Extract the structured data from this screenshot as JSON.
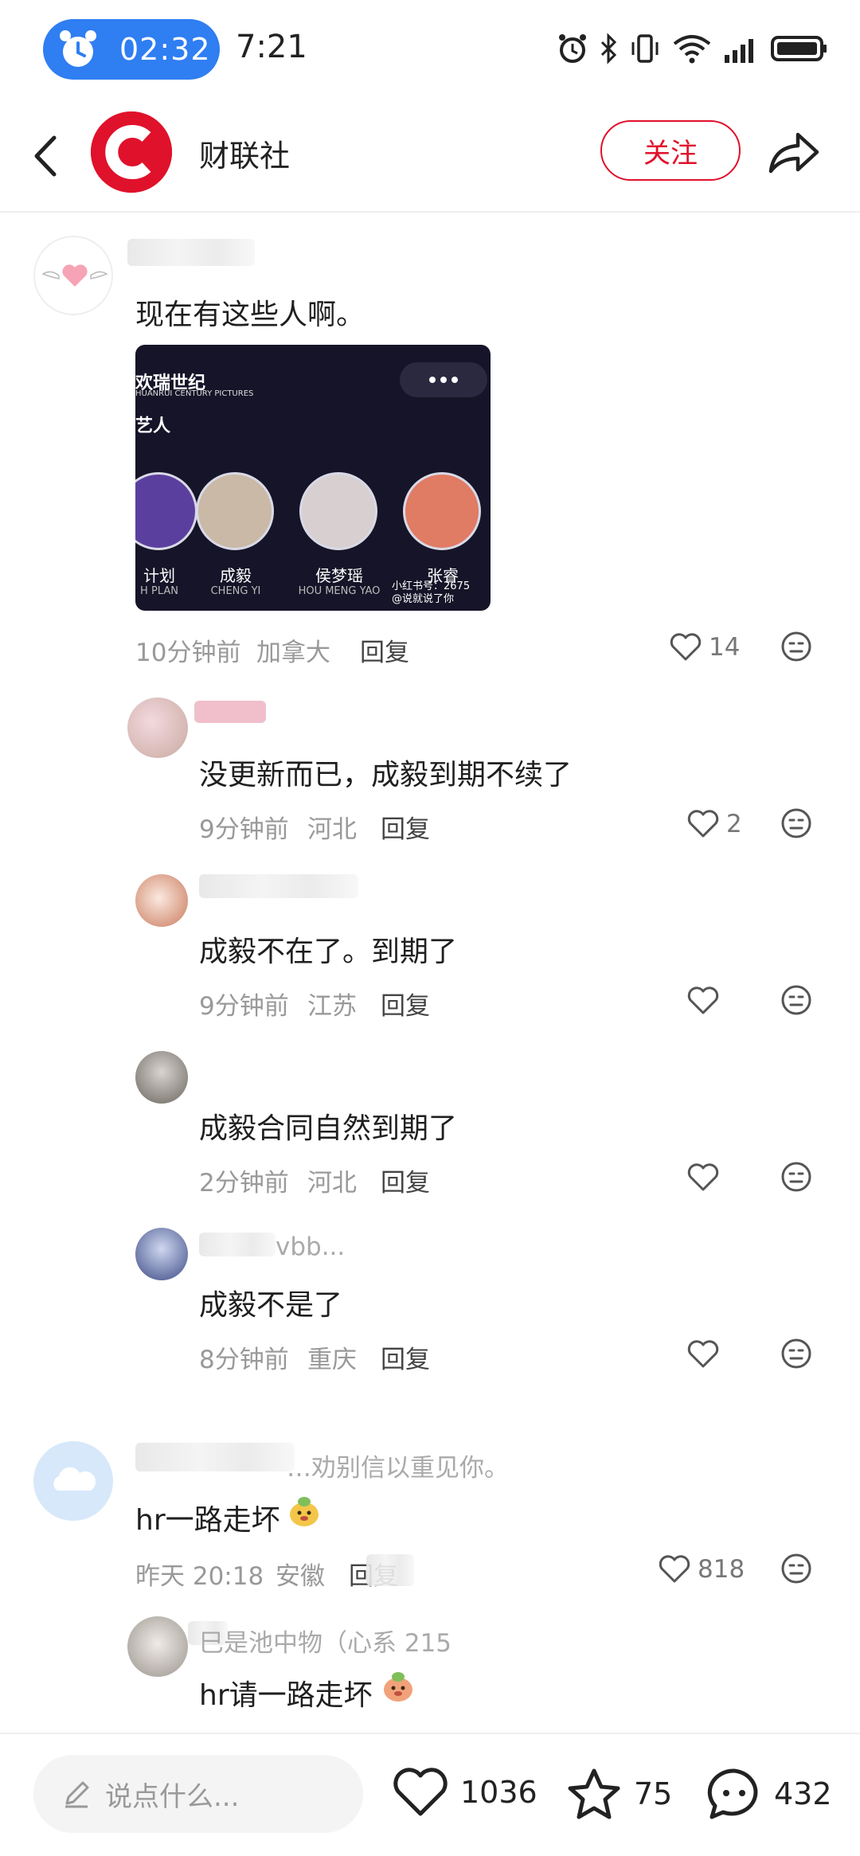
{
  "status_bar": {
    "alarm_time": "02:32",
    "clock": "7:21"
  },
  "header": {
    "brand_name": "财联社",
    "follow_label": "关注"
  },
  "comments": [
    {
      "text": "现在有这些人啊。",
      "time": "10分钟前",
      "location": "加拿大",
      "reply_label": "回复",
      "likes": "14",
      "image": {
        "studio": "欢瑞世纪",
        "studio_sub": "HUANRUI CENTURY PICTURES",
        "section": "艺人",
        "stars": [
          {
            "name": "计划",
            "en": "H PLAN"
          },
          {
            "name": "成毅",
            "en": "CHENG YI"
          },
          {
            "name": "侯梦瑶",
            "en": "HOU MENG YAO"
          },
          {
            "name": "张睿",
            "en": ""
          }
        ],
        "watermark_1": "小红书号：2675",
        "watermark_2": "@说就说了你"
      }
    },
    {
      "text": "没更新而已，成毅到期不续了",
      "time": "9分钟前",
      "location": "河北",
      "reply_label": "回复",
      "likes": "2"
    },
    {
      "text": "成毅不在了。到期了",
      "time": "9分钟前",
      "location": "江苏",
      "reply_label": "回复",
      "likes": ""
    },
    {
      "text": "成毅合同自然到期了",
      "time": "2分钟前",
      "location": "河北",
      "reply_label": "回复",
      "likes": ""
    },
    {
      "text": "成毅不是了",
      "time": "8分钟前",
      "location": "重庆",
      "reply_label": "回复",
      "likes": "",
      "name_fragment": "vbb..."
    },
    {
      "text": "hr一路走坏",
      "time": "昨天 20:18",
      "location": "安徽",
      "reply_label": "回复",
      "likes": "818",
      "name_fragment": "…劝别信以重见你。"
    },
    {
      "text": "hr请一路走坏",
      "name_fragment": "巳是池中物（心系 215"
    }
  ],
  "bottom_bar": {
    "input_placeholder": "说点什么...",
    "likes_count": "1036",
    "stars_count": "75",
    "comments_count": "432"
  }
}
